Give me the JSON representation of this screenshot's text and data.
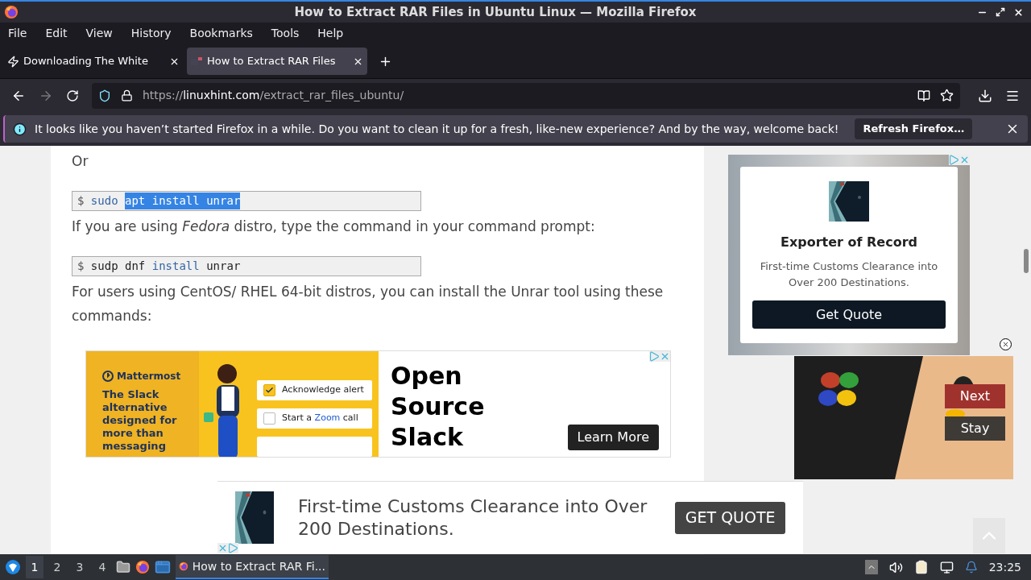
{
  "window": {
    "title": "How to Extract RAR Files in Ubuntu Linux — Mozilla Firefox"
  },
  "menu": [
    "File",
    "Edit",
    "View",
    "History",
    "Bookmarks",
    "Tools",
    "Help"
  ],
  "tabs": [
    {
      "label": "Downloading The White",
      "selected": false
    },
    {
      "label": "How to Extract RAR Files",
      "selected": true
    }
  ],
  "url": {
    "scheme": "https://",
    "host": "linuxhint.com",
    "path": "/extract_rar_files_ubuntu/"
  },
  "notification": {
    "message": "It looks like you haven’t started Firefox in a while. Do you want to clean it up for a fresh, like-new experience? And by the way, welcome back!",
    "button": "Refresh Firefox…"
  },
  "article": [
    {
      "kind": "paragraph",
      "text": "Or"
    },
    {
      "kind": "code",
      "tokens": [
        {
          "text": "$ ",
          "kind": "prompt",
          "selected": false
        },
        {
          "text": "sudo ",
          "kind": "keyword",
          "selected": false
        },
        {
          "text": "apt install unrar",
          "kind": "keyword",
          "selected": true
        }
      ]
    },
    {
      "kind": "paragraph",
      "text": "If you are using *Fedora* distro, type the command in your command prompt:"
    },
    {
      "kind": "code",
      "tokens": [
        {
          "text": "$ ",
          "kind": "prompt",
          "selected": false
        },
        {
          "text": "sudp dnf ",
          "kind": "plain",
          "selected": false
        },
        {
          "text": "install",
          "kind": "keyword",
          "selected": false
        },
        {
          "text": " unrar",
          "kind": "plain",
          "selected": false
        }
      ]
    },
    {
      "kind": "paragraph",
      "text": "For users using CentOS/ RHEL 64-bit distros, you can install the Unrar tool using these commands:"
    }
  ],
  "inline_ad": {
    "brand": "Mattermost",
    "headline": "The Slack alternative designed for more than messaging",
    "checklist": [
      {
        "parts": [
          {
            "text": "Acknowledge alert",
            "highlight": false
          }
        ],
        "checked": true
      },
      {
        "parts": [
          {
            "text": "Start a ",
            "highlight": false
          },
          {
            "text": "Zoom",
            "highlight": true
          },
          {
            "text": " call",
            "highlight": false
          }
        ],
        "checked": false
      }
    ],
    "title_lines": [
      "Open",
      "Source",
      "Slack"
    ],
    "button": "Learn More"
  },
  "side_ad": {
    "title": "Exporter of Record",
    "text": "First-time Customs Clearance into Over 200 Destinations.",
    "button": "Get Quote"
  },
  "video_popup": {
    "buttons": [
      {
        "label": "Next",
        "kind": "primary"
      },
      {
        "label": "Stay",
        "kind": "secondary"
      }
    ]
  },
  "bottom_ad": {
    "text": "First-time Customs Clearance into Over 200 Destinations.",
    "button": "GET QUOTE"
  },
  "taskbar": {
    "workspaces": [
      {
        "label": "1",
        "selected": true
      },
      {
        "label": "2",
        "selected": false
      },
      {
        "label": "3",
        "selected": false
      },
      {
        "label": "4",
        "selected": false
      }
    ],
    "tasks": [
      {
        "label": "How to Extract RAR Fi...",
        "selected": true
      }
    ],
    "clock": "23:25"
  }
}
